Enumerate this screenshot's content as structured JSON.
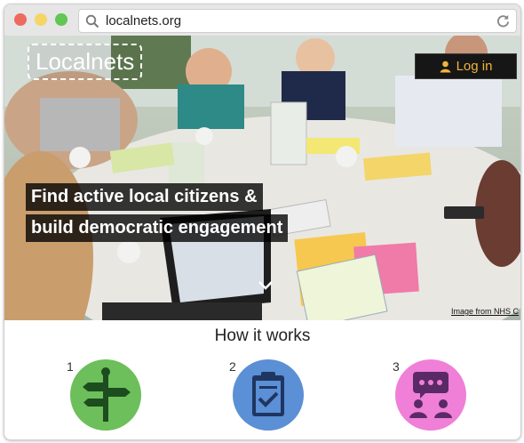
{
  "browser": {
    "url": "localnets.org"
  },
  "hero": {
    "logo_text": "Localnets",
    "login_label": "Log in",
    "headline_line1": "Find active local citizens &",
    "headline_line2": "build democratic engagement",
    "credit": "Image from NHS C"
  },
  "how": {
    "title": "How it works",
    "steps": [
      {
        "number": "1",
        "icon": "signpost-icon",
        "color": "#6cbf5a"
      },
      {
        "number": "2",
        "icon": "clipboard-check-icon",
        "color": "#5b8fd6"
      },
      {
        "number": "3",
        "icon": "group-chat-icon",
        "color": "#f07fd8"
      }
    ]
  },
  "colors": {
    "login_text": "#f0b53a",
    "login_bg": "#161616"
  }
}
